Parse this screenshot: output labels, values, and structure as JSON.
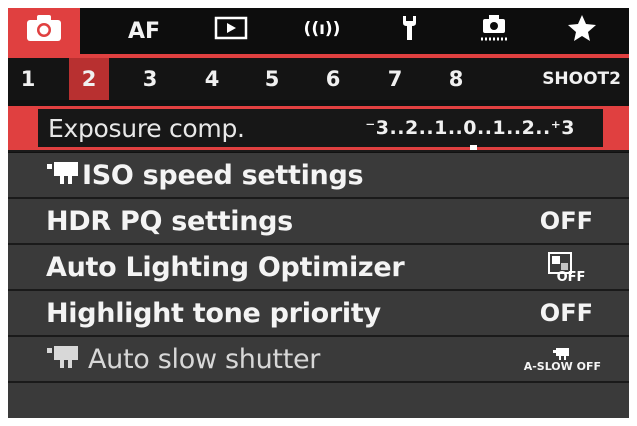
{
  "tabs": [
    {
      "id": "shoot",
      "icon": "camera-icon",
      "label": "",
      "active": true
    },
    {
      "id": "af",
      "icon": "",
      "label": "AF",
      "active": false
    },
    {
      "id": "playback",
      "icon": "playback-icon",
      "label": "",
      "active": false
    },
    {
      "id": "wireless",
      "icon": "wireless-icon",
      "label": "",
      "active": false
    },
    {
      "id": "setup",
      "icon": "wrench-icon",
      "label": "",
      "active": false
    },
    {
      "id": "custom",
      "icon": "custom-functions-icon",
      "label": "",
      "active": false
    },
    {
      "id": "mymenu",
      "icon": "star-icon",
      "label": "",
      "active": false
    }
  ],
  "pages": [
    "1",
    "2",
    "3",
    "4",
    "5",
    "6",
    "7",
    "8"
  ],
  "active_page": "2",
  "page_name": "SHOOT2",
  "menu": [
    {
      "label": "Exposure comp.",
      "value": "⁻3..2..1..0..1..2..⁺3",
      "state": "selected"
    },
    {
      "label": "ISO speed settings",
      "value": "",
      "state": "normal",
      "icon": "movie-icon"
    },
    {
      "label": "HDR PQ settings",
      "value": "OFF",
      "state": "normal"
    },
    {
      "label": "Auto Lighting Optimizer",
      "value": "OFF",
      "state": "normal",
      "value_icon": "alo-icon"
    },
    {
      "label": "Highlight tone priority",
      "value": "OFF",
      "state": "normal"
    },
    {
      "label": "Auto slow shutter",
      "value": "A-SLOW OFF",
      "state": "disabled",
      "icon": "movie-icon"
    }
  ],
  "colors": {
    "accent": "#e04040",
    "row": "#3a3a3a",
    "bg": "#111111"
  }
}
